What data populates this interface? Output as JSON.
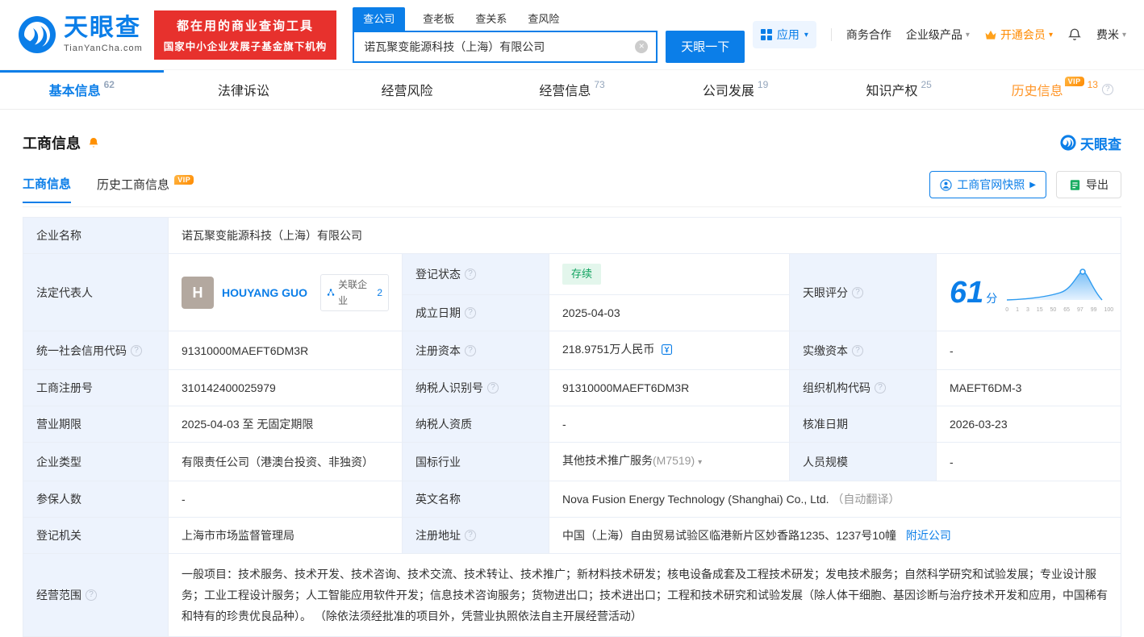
{
  "brand": {
    "name": "天眼查",
    "domain": "TianYanCha.com",
    "banner_line1": "都在用的商业查询工具",
    "banner_line2": "国家中小企业发展子基金旗下机构"
  },
  "icons": {
    "help": "?",
    "caret": "▾",
    "clear": "×",
    "arrow": "▶",
    "vip": "VIP"
  },
  "search": {
    "tabs": [
      {
        "label": "查公司"
      },
      {
        "label": "查老板"
      },
      {
        "label": "查关系"
      },
      {
        "label": "查风险"
      }
    ],
    "value": "诺瓦聚变能源科技（上海）有限公司",
    "button": "天眼一下"
  },
  "top_menu": {
    "apps": "应用",
    "cooperation": "商务合作",
    "enterprise": "企业级产品",
    "vip": "开通会员",
    "user": "费米"
  },
  "nav_tabs": [
    {
      "label": "基本信息",
      "count": "62"
    },
    {
      "label": "法律诉讼",
      "count": ""
    },
    {
      "label": "经营风险",
      "count": ""
    },
    {
      "label": "经营信息",
      "count": "73"
    },
    {
      "label": "公司发展",
      "count": "19"
    },
    {
      "label": "知识产权",
      "count": "25"
    },
    {
      "label": "历史信息",
      "count": "13"
    }
  ],
  "section": {
    "title": "工商信息",
    "subtab_current": "工商信息",
    "subtab_history": "历史工商信息",
    "snapshot_button": "工商官网快照",
    "export_button": "导出",
    "logo_text": "天眼查"
  },
  "score": {
    "label": "天眼评分",
    "value": "61",
    "unit": "分",
    "ticks": "0 1 3 15 50 65 97 99 100"
  },
  "fields": {
    "company_name": {
      "label": "企业名称",
      "value": "诺瓦聚变能源科技（上海）有限公司"
    },
    "legal_rep": {
      "label": "法定代表人",
      "avatar": "H",
      "name": "HOUYANG GUO",
      "related_label": "关联企业",
      "related_count": "2"
    },
    "reg_status": {
      "label": "登记状态",
      "value": "存续"
    },
    "establish_date": {
      "label": "成立日期",
      "value": "2025-04-03"
    },
    "credit_code": {
      "label": "统一社会信用代码",
      "value": "91310000MAEFT6DM3R"
    },
    "reg_capital": {
      "label": "注册资本",
      "value": "218.9751万人民币"
    },
    "paid_capital": {
      "label": "实缴资本",
      "value": "-"
    },
    "reg_no": {
      "label": "工商注册号",
      "value": "310142400025979"
    },
    "taxpayer_no": {
      "label": "纳税人识别号",
      "value": "91310000MAEFT6DM3R"
    },
    "org_code": {
      "label": "组织机构代码",
      "value": "MAEFT6DM-3"
    },
    "term": {
      "label": "营业期限",
      "value": "2025-04-03 至 无固定期限"
    },
    "taxpayer_quality": {
      "label": "纳税人资质",
      "value": "-"
    },
    "approve_date": {
      "label": "核准日期",
      "value": "2026-03-23"
    },
    "company_type": {
      "label": "企业类型",
      "value": "有限责任公司（港澳台投资、非独资）"
    },
    "industry": {
      "label": "国标行业",
      "value": "其他技术推广服务",
      "code": "(M7519)"
    },
    "staff_size": {
      "label": "人员规模",
      "value": "-"
    },
    "insured_num": {
      "label": "参保人数",
      "value": "-"
    },
    "english_name": {
      "label": "英文名称",
      "value": "Nova Fusion Energy Technology (Shanghai) Co., Ltd.",
      "note": "（自动翻译）"
    },
    "reg_authority": {
      "label": "登记机关",
      "value": "上海市市场监督管理局"
    },
    "address": {
      "label": "注册地址",
      "value": "中国（上海）自由贸易试验区临港新片区妙香路1235、1237号10幢",
      "nearby_link": "附近公司"
    },
    "scope": {
      "label": "经营范围",
      "value": "一般项目：技术服务、技术开发、技术咨询、技术交流、技术转让、技术推广；新材料技术研发；核电设备成套及工程技术研发；发电技术服务；自然科学研究和试验发展；专业设计服务；工业工程设计服务；人工智能应用软件开发；信息技术咨询服务；货物进出口；技术进出口；工程和技术研究和试验发展（除人体干细胞、基因诊断与治疗技术开发和应用，中国稀有和特有的珍贵优良品种）。 （除依法须经批准的项目外，凭营业执照依法自主开展经营活动）"
    }
  },
  "colors": {
    "accent_blue": "#0b7ee8",
    "brand_red": "#e7312d",
    "vip_orange": "#ff8a00",
    "status_green": "#10a35f",
    "label_cell_bg": "#edf3fd"
  }
}
